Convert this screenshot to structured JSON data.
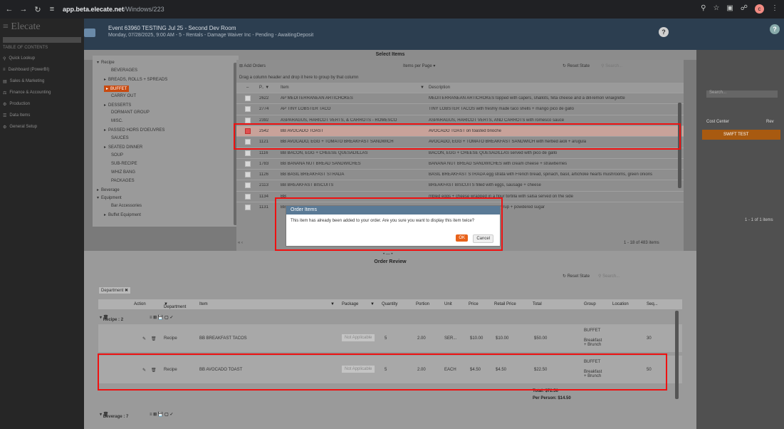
{
  "browser": {
    "url_host": "app.beta.elecate.net",
    "url_path": "/Windows/223"
  },
  "sidebar": {
    "brand": "≡ Elecate",
    "toc": "TABLE OF CONTENTS",
    "items": [
      {
        "label": "Quick Lookup",
        "icon": "search-icon"
      },
      {
        "label": "Dashboard (PowerBI)",
        "icon": "chart-icon"
      },
      {
        "label": "Sales & Marketing",
        "icon": "megaphone-icon"
      },
      {
        "label": "Finance & Accounting",
        "icon": "money-icon"
      },
      {
        "label": "Production",
        "icon": "gear-icon"
      },
      {
        "label": "Data Items",
        "icon": "database-icon"
      },
      {
        "label": "General Setup",
        "icon": "settings-icon"
      }
    ]
  },
  "event": {
    "title": "Event 63960 TESTING Jul 25 - Second Dev Room",
    "subtitle": "Monday, 07/28/2025, 9:00 AM - 5 - Rentals - Damage Waiver Inc - Pending - AwaitingDeposit"
  },
  "right_panel": {
    "search": "Search...",
    "cols": [
      "Cost Center",
      "Rev"
    ],
    "row_value": "SWIFT TEST",
    "footer": "1 - 1 of 1 items"
  },
  "select_items": {
    "title": "Select Items",
    "add_orders": "Add Orders",
    "items_per_page": "Items per Page",
    "reset_state": "Reset State",
    "search_placeholder": "Search...",
    "drag_hint": "Drag a column header and drop it here to group by that column",
    "columns": [
      "P..",
      "Item",
      "Description"
    ],
    "pager": "1 - 18 of 483 items",
    "tree": [
      {
        "label": "Recipe",
        "level": 0,
        "caret": "▾"
      },
      {
        "label": "BEVERAGES",
        "level": 2,
        "caret": ""
      },
      {
        "label": "BREADS, ROLLS + SPREADS",
        "level": 1,
        "caret": "▸"
      },
      {
        "label": "BUFFET",
        "level": 1,
        "caret": "▸",
        "selected": true
      },
      {
        "label": "CARRY OUT",
        "level": 2,
        "caret": ""
      },
      {
        "label": "DESSERTS",
        "level": 1,
        "caret": "▸"
      },
      {
        "label": "DORMANT GROUP",
        "level": 2,
        "caret": ""
      },
      {
        "label": "MISC.",
        "level": 2,
        "caret": ""
      },
      {
        "label": "PASSED HORS D'OEUVRES",
        "level": 1,
        "caret": "▸"
      },
      {
        "label": "SAUCES",
        "level": 2,
        "caret": ""
      },
      {
        "label": "SEATED DINNER",
        "level": 1,
        "caret": "▸"
      },
      {
        "label": "SOUP",
        "level": 2,
        "caret": ""
      },
      {
        "label": "SUB-RECIPE",
        "level": 2,
        "caret": ""
      },
      {
        "label": "WHIZ BANG",
        "level": 2,
        "caret": ""
      },
      {
        "label": "PACKAGES",
        "level": 2,
        "caret": ""
      },
      {
        "label": "Beverage",
        "level": 0,
        "caret": "▸"
      },
      {
        "label": "Equipment",
        "level": 0,
        "caret": "▾"
      },
      {
        "label": "Bar Accessories",
        "level": 2,
        "caret": ""
      },
      {
        "label": "Buffet Equipment",
        "level": 1,
        "caret": "▸"
      }
    ],
    "rows": [
      {
        "p": "2622",
        "item": "AP MEDITERRANEAN ARTICHOKES",
        "desc": "MEDITERRANEAN ARTICHOKES topped with capers, shallots, feta cheese and a dill-lemon vinaigrette",
        "checked": false
      },
      {
        "p": "2774",
        "item": "AP TINY LOBSTER TACO",
        "desc": "TINY LOBSTER TACOS with freshly made taco shells + mango pico de gallo",
        "checked": false
      },
      {
        "p": "2392",
        "item": "ASPARAGUS, HARICOT VERTS, & CARROTS - ROMESCO",
        "desc": "ASPARAGUS, HARICOT VERTS, AND CARROTS with romesco sauce",
        "checked": false
      },
      {
        "p": "2542",
        "item": "BB AVOCADO TOAST",
        "desc": "AVOCADO TOAST on toasted brioche",
        "checked": true
      },
      {
        "p": "1121",
        "item": "BB AVOCADO, EGG + TOMATO BREAKFAST SANDWICH",
        "desc": "AVOCADO, EGG + TOMATO BREAKFAST SANDWICH with herbed aioli + arugula",
        "checked": false
      },
      {
        "p": "1116",
        "item": "BB BACON, EGG + CHEESE QUESADILLAS",
        "desc": "BACON, EGG + CHEESE QUESADILLAS served with pico de gallo",
        "checked": false
      },
      {
        "p": "1783",
        "item": "BB BANANA NUT BREAD SANDWICHES",
        "desc": "BANANA NUT BREAD SANDWICHES with cream cheese + strawberries",
        "checked": false
      },
      {
        "p": "1126",
        "item": "BB BASIL BREAKFAST STRADA",
        "desc": "BASIL BREAKFAST STRADA egg strata with French bread, spinach, basil, artichoke hearts mushrooms, green onions",
        "checked": false
      },
      {
        "p": "2113",
        "item": "BB BREAKFAST BISCUITS",
        "desc": "BREAKFAST BISCUITS filled with eggs, sausage + cheese",
        "checked": false
      },
      {
        "p": "1134",
        "item": "BB",
        "desc": "mbled eggs + cheese wrapped in a flour tortilla with salsa served on the side",
        "checked": false
      },
      {
        "p": "1131",
        "item": "BB",
        "desc": "CH FRENCH TOAST with cinnamon syrup + powdered sugar",
        "checked": false
      }
    ]
  },
  "modal": {
    "title": "Order Items",
    "message": "This item has already been added to your order. Are you sure you want to display this item twice?",
    "ok": "OK",
    "cancel": "Cancel"
  },
  "order_review": {
    "title": "Order Review",
    "reset_state": "Reset State",
    "search_placeholder": "Search...",
    "department_chip": "Department",
    "columns": [
      "Action",
      "Department",
      "Item",
      "Package",
      "Quantity",
      "Portion",
      "Unit",
      "Price",
      "Retail Price",
      "Total",
      "Group",
      "Location",
      "Seq..."
    ],
    "group_recipe": "Recipe : 2",
    "group_beverage": "Beverage : 7",
    "rows": [
      {
        "dept": "Recipe",
        "item": "BB BREAKFAST TACOS",
        "package": "Not Applicable",
        "qty": "5",
        "portion": "2.00",
        "unit": "SER...",
        "price": "$10.00",
        "retail": "$10.00",
        "total": "$50.00",
        "group": "BUFFET",
        "group2": "Breakfast + Brunch",
        "seq": "30"
      },
      {
        "dept": "Recipe",
        "item": "BB AVOCADO TOAST",
        "package": "Not Applicable",
        "qty": "5",
        "portion": "2.00",
        "unit": "EACH",
        "price": "$4.50",
        "retail": "$4.50",
        "total": "$22.50",
        "group": "BUFFET",
        "group2": "Breakfast + Brunch",
        "seq": "50"
      }
    ],
    "total": "Total: $72.50",
    "per_person": "Per Person: $14.50"
  }
}
